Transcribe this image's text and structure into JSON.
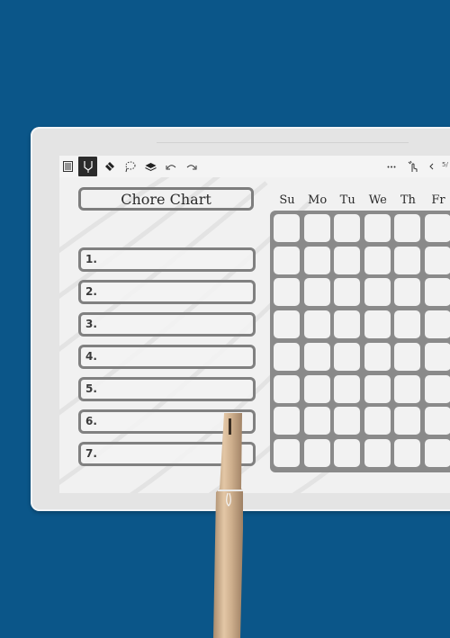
{
  "toolbar": {
    "icons": [
      "toc-icon",
      "pen-icon",
      "eraser-icon",
      "lasso-icon",
      "layers-icon",
      "undo-icon",
      "redo-icon"
    ],
    "right_icons": [
      "more-icon",
      "touch-icon",
      "prev-page-icon"
    ],
    "page_indicator": "5/"
  },
  "template": {
    "title": "Chore Chart",
    "chores": [
      "1.",
      "2.",
      "3.",
      "4.",
      "5.",
      "6.",
      "7."
    ],
    "days": [
      "Su",
      "Mo",
      "Tu",
      "We",
      "Th",
      "Fr"
    ],
    "grid_rows": 8
  },
  "colors": {
    "background": "#0b5689",
    "border": "#808080",
    "paper": "#f1f1f1"
  }
}
